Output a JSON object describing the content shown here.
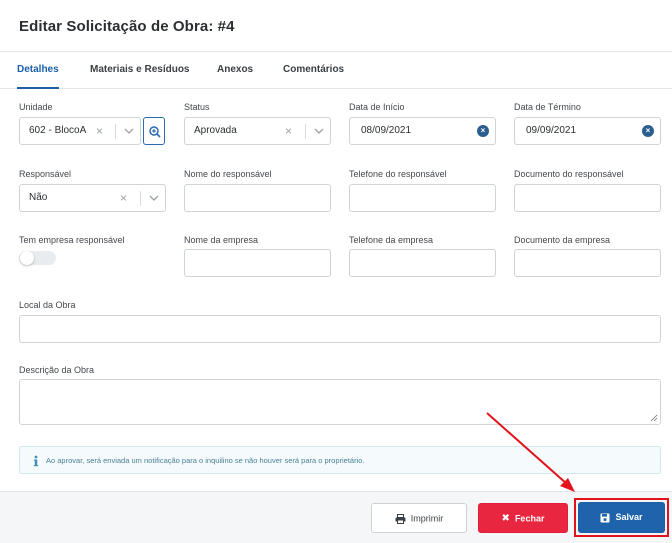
{
  "modal": {
    "title": "Editar Solicitação de Obra: #4"
  },
  "tabs": [
    {
      "label": "Detalhes",
      "active": true
    },
    {
      "label": "Materiais e Resíduos",
      "active": false
    },
    {
      "label": "Anexos",
      "active": false
    },
    {
      "label": "Comentários",
      "active": false
    }
  ],
  "form": {
    "unidade": {
      "label": "Unidade",
      "value": "602 - BlocoA"
    },
    "status": {
      "label": "Status",
      "value": "Aprovada"
    },
    "data_inicio": {
      "label": "Data de Início",
      "value": "08/09/2021"
    },
    "data_termino": {
      "label": "Data de Término",
      "value": "09/09/2021"
    },
    "responsavel": {
      "label": "Responsável",
      "value": "Não"
    },
    "nome_responsavel": {
      "label": "Nome do responsável",
      "value": ""
    },
    "telefone_responsavel": {
      "label": "Telefone do responsável",
      "value": ""
    },
    "documento_responsavel": {
      "label": "Documento do responsável",
      "value": ""
    },
    "tem_empresa": {
      "label": "Tem empresa responsável",
      "checked": false
    },
    "nome_empresa": {
      "label": "Nome da empresa",
      "value": ""
    },
    "telefone_empresa": {
      "label": "Telefone da empresa",
      "value": ""
    },
    "documento_empresa": {
      "label": "Documento da empresa",
      "value": ""
    },
    "local_obra": {
      "label": "Local da Obra",
      "value": ""
    },
    "descricao_obra": {
      "label": "Descrição da Obra",
      "value": ""
    }
  },
  "alert": {
    "message": "Ao aprovar, será enviada um notificação para o inquilino se não houver será para o proprietário."
  },
  "footer": {
    "print_label": "Imprimir",
    "close_label": "Fechar",
    "save_label": "Salvar"
  },
  "colors": {
    "primary": "#1f63ad",
    "danger": "#e8263f",
    "active_tab": "#1b5fa8",
    "annotation": "#e2131c"
  },
  "icons": {
    "search": "magnifier-plus-icon",
    "print": "printer-icon",
    "close": "times-icon",
    "save": "floppy-disk-icon",
    "info": "info-icon"
  }
}
